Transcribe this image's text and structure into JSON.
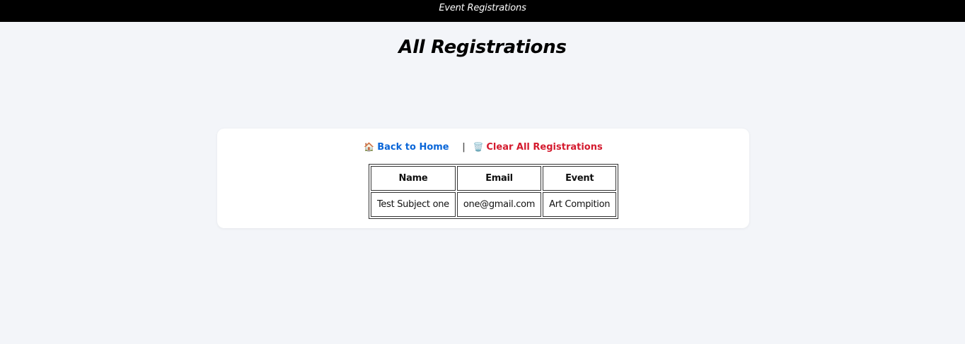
{
  "header": {
    "title": "Event Registrations"
  },
  "page": {
    "title": "All Registrations"
  },
  "nav": {
    "home_icon": "🏠",
    "home_label": "Back to Home",
    "separator": "|",
    "clear_icon": "🗑️",
    "clear_label": "Clear All Registrations"
  },
  "table": {
    "columns": [
      "Name",
      "Email",
      "Event"
    ],
    "rows": [
      [
        "Test Subject one",
        "one@gmail.com",
        "Art Compition"
      ]
    ]
  },
  "colors": {
    "topbar": "#000000",
    "background": "#f3f5f9",
    "home_link": "#0a66d8",
    "clear_link": "#d41a2e"
  }
}
